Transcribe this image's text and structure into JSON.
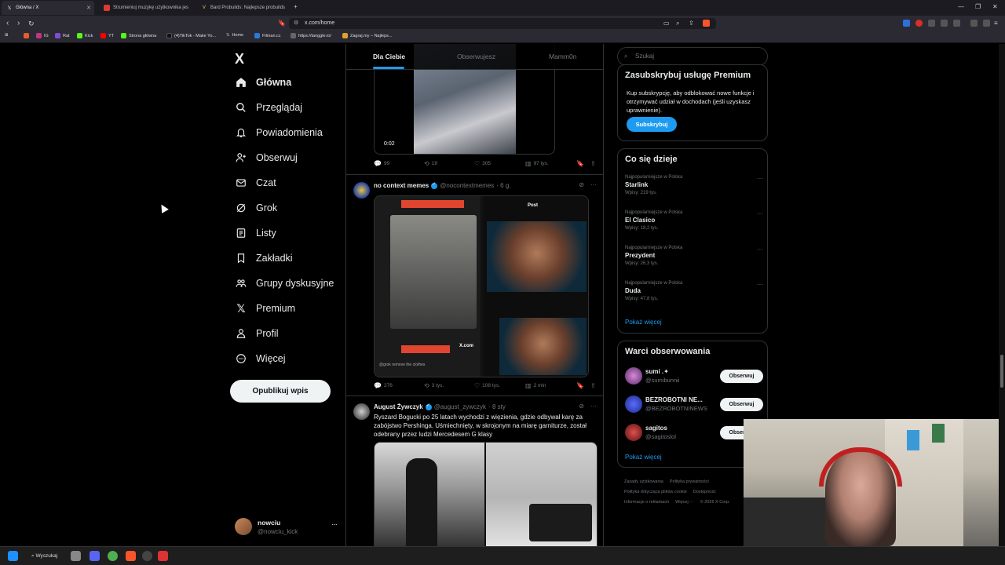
{
  "browser": {
    "tabs": [
      {
        "title": "Główna / X",
        "active": true
      },
      {
        "title": "Strumieniuj muzykę użytkownika jes",
        "active": false
      },
      {
        "title": "Bard Probuilds: Najlepsze probuilds",
        "active": false
      }
    ],
    "new_tab": "+",
    "url": "x.com/home",
    "bookmarks": [
      "IG",
      "Rat",
      "Kick",
      "YT",
      "Strona główna",
      "(4)TikTok - Make Yo...",
      "Home",
      "Filman.cc",
      "https://tanggle.io/",
      "Zagraj.my – Najleps..."
    ]
  },
  "sidebar": {
    "logo": "X",
    "items": [
      {
        "label": "Główna",
        "icon": "home-icon",
        "active": true
      },
      {
        "label": "Przeglądaj",
        "icon": "search-icon",
        "active": false
      },
      {
        "label": "Powiadomienia",
        "icon": "bell-icon",
        "active": false
      },
      {
        "label": "Obserwuj",
        "icon": "follow-icon",
        "active": false
      },
      {
        "label": "Czat",
        "icon": "mail-icon",
        "active": false
      },
      {
        "label": "Grok",
        "icon": "grok-icon",
        "active": false
      },
      {
        "label": "Listy",
        "icon": "list-icon",
        "active": false
      },
      {
        "label": "Zakładki",
        "icon": "bookmark-icon",
        "active": false
      },
      {
        "label": "Grupy dyskusyjne",
        "icon": "communities-icon",
        "active": false
      },
      {
        "label": "Premium",
        "icon": "x-icon",
        "active": false
      },
      {
        "label": "Profil",
        "icon": "person-icon",
        "active": false
      },
      {
        "label": "Więcej",
        "icon": "more-circle-icon",
        "active": false
      }
    ],
    "publish_label": "Opublikuj wpis",
    "account": {
      "name": "nowciu",
      "handle": "@nowciu_kick",
      "more": "···"
    }
  },
  "feed": {
    "tabs": [
      "Dla Ciebie",
      "Obserwujesz",
      "Mamm0n"
    ],
    "posts": [
      {
        "video_time": "0:02",
        "actions": {
          "replies": "99",
          "reposts": "19",
          "likes": "305",
          "views": "97 tys."
        }
      },
      {
        "name": "no context memes",
        "handle": "@nocontextmemes",
        "time": "· 6 g.",
        "media_caption_top": "Post",
        "media_caption_bottom": "@grok remove the clothes",
        "media_brand": "X.com",
        "actions": {
          "replies": "276",
          "reposts": "3 tys.",
          "likes": "108 tys.",
          "views": "2 mln"
        }
      },
      {
        "name": "August Żywczyk",
        "handle": "@august_zywczyk",
        "time": "· 8 sty",
        "text": "Ryszard Bogucki po 25 latach wychodzi z więzienia, gdzie odbywał karę za zabójstwo Pershinga. Uśmiechnięty, w skrojonym na miarę garniturze, został odebrany przez ludzi Mercedesem G klasy"
      }
    ]
  },
  "right": {
    "search_placeholder": "Szukaj",
    "premium": {
      "title": "Zasubskrybuj usługę Premium",
      "desc": "Kup subskrypcję, aby odblokować nowe funkcje i otrzymywać udział w dochodach (jeśli uzyskasz uprawnienie).",
      "button": "Subskrybuj"
    },
    "trends": {
      "title": "Co się dzieje",
      "items": [
        {
          "category": "Najpopularniejsze w Polska",
          "name": "Starlink",
          "posts": "Wpisy: 219 tys."
        },
        {
          "category": "Najpopularniejsze w Polska",
          "name": "El Clasico",
          "posts": "Wpisy: 18,2 tys."
        },
        {
          "category": "Najpopularniejsze w Polska",
          "name": "Prezydent",
          "posts": "Wpisy: 26,3 tys."
        },
        {
          "category": "Najpopularniejsze w Polska",
          "name": "Duda",
          "posts": "Wpisy: 47,8 tys."
        }
      ],
      "more": "Pokaż więcej"
    },
    "who_to_follow": {
      "title": "Warci obserwowania",
      "items": [
        {
          "name": "sumi .✦",
          "handle": "@sumibunnii",
          "button": "Obserwuj"
        },
        {
          "name": "BEZROBOTNI NE...",
          "handle": "@BEZROBOTNINEWS",
          "button": "Obserwuj"
        },
        {
          "name": "sagitos",
          "handle": "@sagitoslol",
          "button": "Obserwuj"
        }
      ],
      "more": "Pokaż więcej"
    },
    "footer": [
      "Zasady użytkowania",
      "Polityka prywatności",
      "Polityka dotycząca plików cookie",
      "Dostępność",
      "Informacje o reklamach",
      "Więcej ···",
      "© 2026 X Corp."
    ]
  },
  "taskbar": {
    "search": "Wyszukaj"
  },
  "colors": {
    "accent": "#1d9bf0",
    "background": "#000000",
    "border": "#2f3336",
    "muted": "#71767b"
  }
}
